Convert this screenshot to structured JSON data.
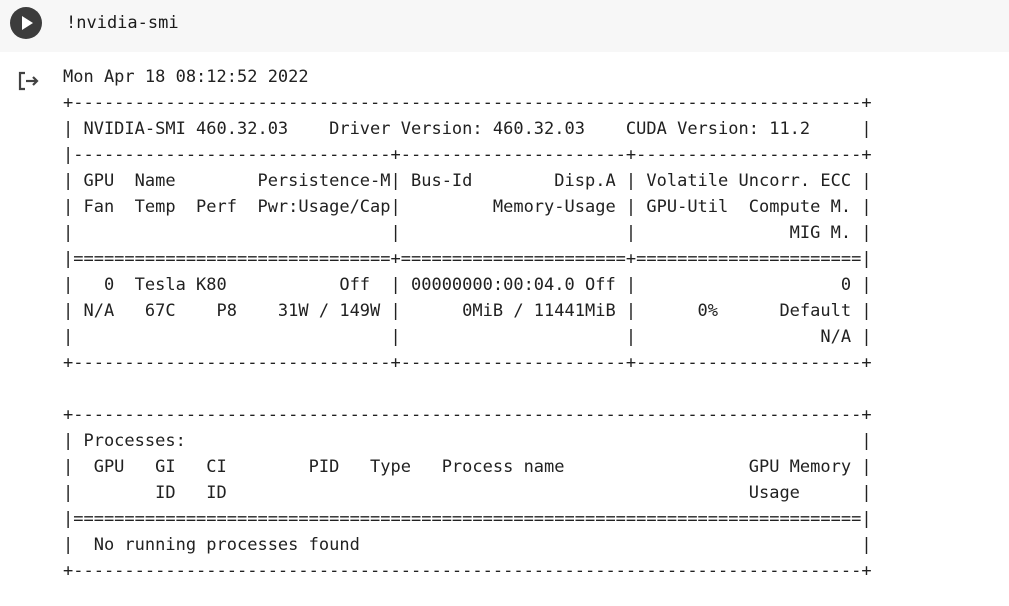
{
  "cell": {
    "code": "!nvidia-smi",
    "run_icon": "play-icon"
  },
  "output": {
    "icon": "output-redirect-icon",
    "lines": [
      "Mon Apr 18 08:12:52 2022",
      "+-----------------------------------------------------------------------------+",
      "| NVIDIA-SMI 460.32.03    Driver Version: 460.32.03    CUDA Version: 11.2     |",
      "|-------------------------------+----------------------+----------------------+",
      "| GPU  Name        Persistence-M| Bus-Id        Disp.A | Volatile Uncorr. ECC |",
      "| Fan  Temp  Perf  Pwr:Usage/Cap|         Memory-Usage | GPU-Util  Compute M. |",
      "|                               |                      |               MIG M. |",
      "|===============================+======================+======================|",
      "|   0  Tesla K80           Off  | 00000000:00:04.0 Off |                    0 |",
      "| N/A   67C    P8    31W / 149W |      0MiB / 11441MiB |      0%      Default |",
      "|                               |                      |                  N/A |",
      "+-------------------------------+----------------------+----------------------+",
      "",
      "+-----------------------------------------------------------------------------+",
      "| Processes:                                                                  |",
      "|  GPU   GI   CI        PID   Type   Process name                  GPU Memory |",
      "|        ID   ID                                                   Usage      |",
      "|=============================================================================|",
      "|  No running processes found                                                 |",
      "+-----------------------------------------------------------------------------+"
    ]
  }
}
